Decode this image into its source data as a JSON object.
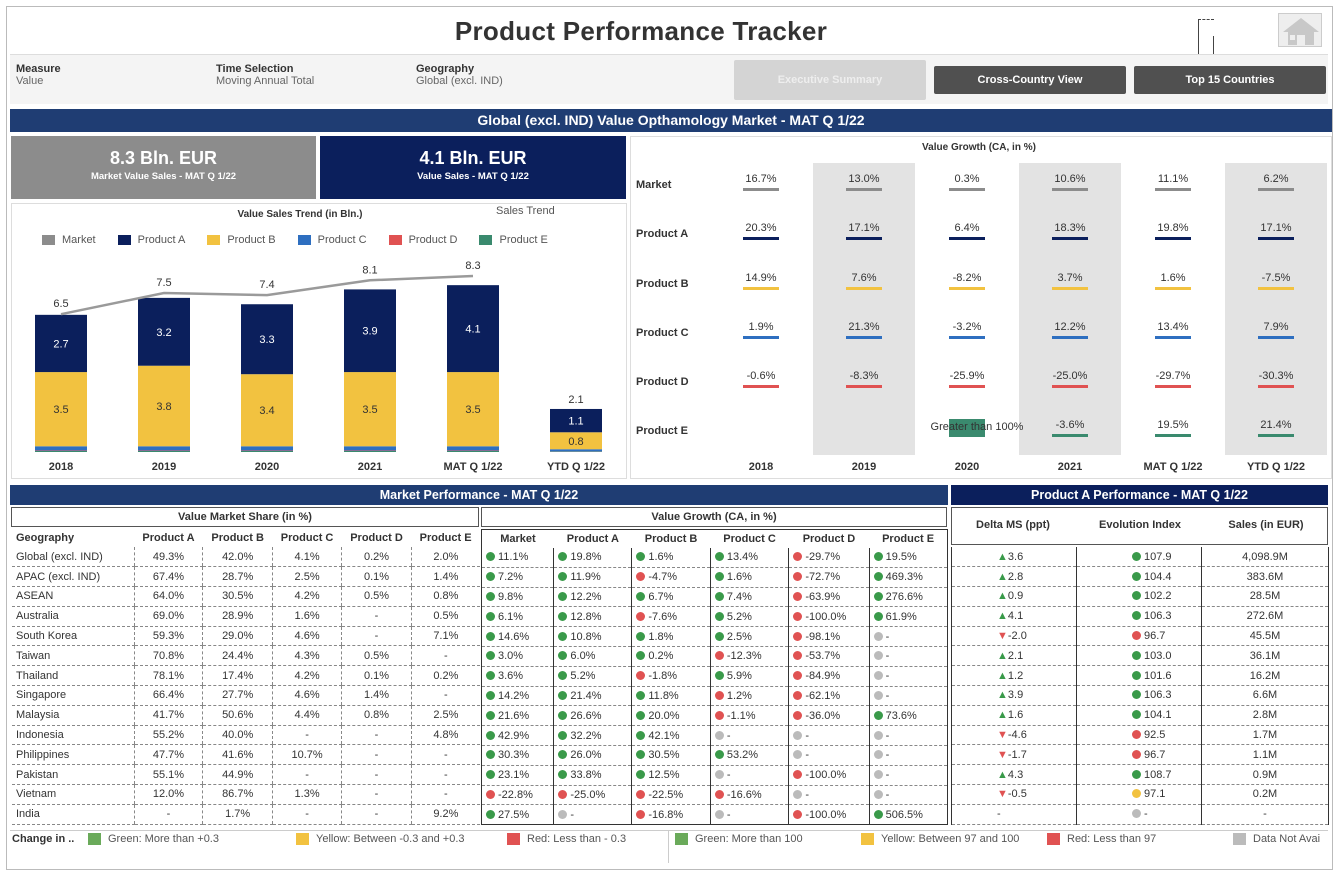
{
  "header": {
    "title": "Product Performance Tracker"
  },
  "filters": [
    {
      "label": "Measure",
      "value": "Value"
    },
    {
      "label": "Time Selection",
      "value": "Moving Annual Total"
    },
    {
      "label": "Geography",
      "value": "Global (excl. IND)"
    }
  ],
  "buttons": {
    "exec": "Executive Summary",
    "cross": "Cross-Country View",
    "top15": "Top 15 Countries"
  },
  "banner": "Global (excl. IND) Value Opthamology Market - MAT Q 1/22",
  "kpis": [
    {
      "value": "8.3 Bln. EUR",
      "label": "Market Value Sales - MAT Q 1/22",
      "color": "#8c8c8c"
    },
    {
      "value": "4.1 Bln. EUR",
      "label": "Value Sales - MAT Q 1/22",
      "color": "#0b1f5c"
    }
  ],
  "trend": {
    "title": "Value Sales Trend (in Bln.)",
    "tab": "Sales Trend"
  },
  "colors": {
    "Market": "#8c8c8c",
    "Product A": "#0b1f5c",
    "Product B": "#f2c240",
    "Product C": "#2e6fc0",
    "Product D": "#e05252",
    "Product E": "#3a8a6e",
    "navy": "#1f3d73",
    "green": "#3a9a4a",
    "red": "#e05252",
    "yellow": "#f2c240",
    "grey": "#bbbbbb"
  },
  "chart_data": {
    "type": "bar",
    "categories": [
      "2018",
      "2019",
      "2020",
      "2021",
      "MAT Q 1/22",
      "YTD Q 1/22"
    ],
    "legend": [
      "Market",
      "Product A",
      "Product B",
      "Product C",
      "Product D",
      "Product E"
    ],
    "series": [
      {
        "name": "Product A",
        "values": [
          2.7,
          3.2,
          3.3,
          3.9,
          4.1,
          1.1
        ]
      },
      {
        "name": "Product B",
        "values": [
          3.5,
          3.8,
          3.4,
          3.5,
          3.5,
          0.8
        ]
      },
      {
        "name": "Product C",
        "values": [
          0.2,
          0.2,
          0.2,
          0.2,
          0.2,
          0.1
        ]
      },
      {
        "name": "Product D",
        "values": [
          0.02,
          0.02,
          0.02,
          0.02,
          0.02,
          0.01
        ]
      },
      {
        "name": "Product E",
        "values": [
          0.05,
          0.05,
          0.05,
          0.05,
          0.05,
          0.02
        ]
      }
    ],
    "totals": [
      "",
      "",
      "",
      "",
      "",
      "2.1"
    ],
    "market": {
      "name": "Market",
      "values": [
        6.5,
        7.5,
        7.4,
        8.1,
        8.3
      ],
      "labels": [
        "6.5",
        "7.5",
        "7.4",
        "8.1",
        "8.3"
      ]
    },
    "ylim": [
      0,
      9
    ]
  },
  "growth": {
    "title": "Value Growth (CA, in %)",
    "years": [
      "2018",
      "2019",
      "2020",
      "2021",
      "MAT Q 1/22",
      "YTD Q 1/22"
    ],
    "rows": [
      {
        "label": "Market",
        "values": [
          "16.7%",
          "13.0%",
          "0.3%",
          "10.6%",
          "11.1%",
          "6.2%"
        ]
      },
      {
        "label": "Product A",
        "values": [
          "20.3%",
          "17.1%",
          "6.4%",
          "18.3%",
          "19.8%",
          "17.1%"
        ]
      },
      {
        "label": "Product B",
        "values": [
          "14.9%",
          "7.6%",
          "-8.2%",
          "3.7%",
          "1.6%",
          "-7.5%"
        ]
      },
      {
        "label": "Product C",
        "values": [
          "1.9%",
          "21.3%",
          "-3.2%",
          "12.2%",
          "13.4%",
          "7.9%"
        ]
      },
      {
        "label": "Product D",
        "values": [
          "-0.6%",
          "-8.3%",
          "-25.9%",
          "-25.0%",
          "-29.7%",
          "-30.3%"
        ]
      },
      {
        "label": "Product E",
        "values": [
          "",
          "",
          "Greater than 100%",
          "-3.6%",
          "19.5%",
          "21.4%"
        ]
      }
    ]
  },
  "market_perf": {
    "banner": "Market Performance - MAT Q 1/22",
    "share_title": "Value Market Share (in %)",
    "growth_title": "Value Growth (CA, in %)",
    "share_headers": [
      "Geography",
      "Product A",
      "Product B",
      "Product C",
      "Product D",
      "Product E"
    ],
    "growth_headers": [
      "Market",
      "Product A",
      "Product B",
      "Product C",
      "Product D",
      "Product E"
    ]
  },
  "prodA": {
    "banner": "Product A Performance - MAT Q 1/22",
    "headers": [
      "Delta MS (ppt)",
      "Evolution Index",
      "Sales (in EUR)"
    ]
  },
  "rows": [
    {
      "geo": "Global (excl. IND)",
      "share": [
        "49.3%",
        "42.0%",
        "4.1%",
        "0.2%",
        "2.0%"
      ],
      "growth": [
        [
          "g",
          "11.1%"
        ],
        [
          "g",
          "19.8%"
        ],
        [
          "g",
          "1.6%"
        ],
        [
          "g",
          "13.4%"
        ],
        [
          "r",
          "-29.7%"
        ],
        [
          "g",
          "19.5%"
        ]
      ],
      "delta": [
        "up",
        "3.6"
      ],
      "ei": [
        "g",
        "107.9"
      ],
      "sales": "4,098.9M"
    },
    {
      "geo": "APAC (excl. IND)",
      "share": [
        "67.4%",
        "28.7%",
        "2.5%",
        "0.1%",
        "1.4%"
      ],
      "growth": [
        [
          "g",
          "7.2%"
        ],
        [
          "g",
          "11.9%"
        ],
        [
          "r",
          "-4.7%"
        ],
        [
          "g",
          "1.6%"
        ],
        [
          "r",
          "-72.7%"
        ],
        [
          "g",
          "469.3%"
        ]
      ],
      "delta": [
        "up",
        "2.8"
      ],
      "ei": [
        "g",
        "104.4"
      ],
      "sales": "383.6M"
    },
    {
      "geo": "ASEAN",
      "share": [
        "64.0%",
        "30.5%",
        "4.2%",
        "0.5%",
        "0.8%"
      ],
      "growth": [
        [
          "g",
          "9.8%"
        ],
        [
          "g",
          "12.2%"
        ],
        [
          "g",
          "6.7%"
        ],
        [
          "g",
          "7.4%"
        ],
        [
          "r",
          "-63.9%"
        ],
        [
          "g",
          "276.6%"
        ]
      ],
      "delta": [
        "up",
        "0.9"
      ],
      "ei": [
        "g",
        "102.2"
      ],
      "sales": "28.5M"
    },
    {
      "geo": "Australia",
      "share": [
        "69.0%",
        "28.9%",
        "1.6%",
        "-",
        "0.5%"
      ],
      "growth": [
        [
          "g",
          "6.1%"
        ],
        [
          "g",
          "12.8%"
        ],
        [
          "r",
          "-7.6%"
        ],
        [
          "g",
          "5.2%"
        ],
        [
          "r",
          "-100.0%"
        ],
        [
          "g",
          "61.9%"
        ]
      ],
      "delta": [
        "up",
        "4.1"
      ],
      "ei": [
        "g",
        "106.3"
      ],
      "sales": "272.6M"
    },
    {
      "geo": "South Korea",
      "share": [
        "59.3%",
        "29.0%",
        "4.6%",
        "-",
        "7.1%"
      ],
      "growth": [
        [
          "g",
          "14.6%"
        ],
        [
          "g",
          "10.8%"
        ],
        [
          "g",
          "1.8%"
        ],
        [
          "g",
          "2.5%"
        ],
        [
          "r",
          "-98.1%"
        ],
        [
          "n",
          "-"
        ]
      ],
      "delta": [
        "down",
        "-2.0"
      ],
      "ei": [
        "r",
        "96.7"
      ],
      "sales": "45.5M"
    },
    {
      "geo": "Taiwan",
      "share": [
        "70.8%",
        "24.4%",
        "4.3%",
        "0.5%",
        "-"
      ],
      "growth": [
        [
          "g",
          "3.0%"
        ],
        [
          "g",
          "6.0%"
        ],
        [
          "g",
          "0.2%"
        ],
        [
          "r",
          "-12.3%"
        ],
        [
          "r",
          "-53.7%"
        ],
        [
          "n",
          "-"
        ]
      ],
      "delta": [
        "up",
        "2.1"
      ],
      "ei": [
        "g",
        "103.0"
      ],
      "sales": "36.1M"
    },
    {
      "geo": "Thailand",
      "share": [
        "78.1%",
        "17.4%",
        "4.2%",
        "0.1%",
        "0.2%"
      ],
      "growth": [
        [
          "g",
          "3.6%"
        ],
        [
          "g",
          "5.2%"
        ],
        [
          "r",
          "-1.8%"
        ],
        [
          "g",
          "5.9%"
        ],
        [
          "r",
          "-84.9%"
        ],
        [
          "n",
          "-"
        ]
      ],
      "delta": [
        "up",
        "1.2"
      ],
      "ei": [
        "g",
        "101.6"
      ],
      "sales": "16.2M"
    },
    {
      "geo": "Singapore",
      "share": [
        "66.4%",
        "27.7%",
        "4.6%",
        "1.4%",
        "-"
      ],
      "growth": [
        [
          "g",
          "14.2%"
        ],
        [
          "g",
          "21.4%"
        ],
        [
          "g",
          "11.8%"
        ],
        [
          "r",
          "1.2%"
        ],
        [
          "r",
          "-62.1%"
        ],
        [
          "n",
          "-"
        ]
      ],
      "delta": [
        "up",
        "3.9"
      ],
      "ei": [
        "g",
        "106.3"
      ],
      "sales": "6.6M"
    },
    {
      "geo": "Malaysia",
      "share": [
        "41.7%",
        "50.6%",
        "4.4%",
        "0.8%",
        "2.5%"
      ],
      "growth": [
        [
          "g",
          "21.6%"
        ],
        [
          "g",
          "26.6%"
        ],
        [
          "g",
          "20.0%"
        ],
        [
          "r",
          "-1.1%"
        ],
        [
          "r",
          "-36.0%"
        ],
        [
          "g",
          "73.6%"
        ]
      ],
      "delta": [
        "up",
        "1.6"
      ],
      "ei": [
        "g",
        "104.1"
      ],
      "sales": "2.8M"
    },
    {
      "geo": "Indonesia",
      "share": [
        "55.2%",
        "40.0%",
        "-",
        "-",
        "4.8%"
      ],
      "growth": [
        [
          "g",
          "42.9%"
        ],
        [
          "g",
          "32.2%"
        ],
        [
          "g",
          "42.1%"
        ],
        [
          "n",
          "-"
        ],
        [
          "n",
          "-"
        ],
        [
          "n",
          "-"
        ]
      ],
      "delta": [
        "down",
        "-4.6"
      ],
      "ei": [
        "r",
        "92.5"
      ],
      "sales": "1.7M"
    },
    {
      "geo": "Philippines",
      "share": [
        "47.7%",
        "41.6%",
        "10.7%",
        "-",
        "-"
      ],
      "growth": [
        [
          "g",
          "30.3%"
        ],
        [
          "g",
          "26.0%"
        ],
        [
          "g",
          "30.5%"
        ],
        [
          "g",
          "53.2%"
        ],
        [
          "n",
          "-"
        ],
        [
          "n",
          "-"
        ]
      ],
      "delta": [
        "down",
        "-1.7"
      ],
      "ei": [
        "r",
        "96.7"
      ],
      "sales": "1.1M"
    },
    {
      "geo": "Pakistan",
      "share": [
        "55.1%",
        "44.9%",
        "-",
        "-",
        "-"
      ],
      "growth": [
        [
          "g",
          "23.1%"
        ],
        [
          "g",
          "33.8%"
        ],
        [
          "g",
          "12.5%"
        ],
        [
          "n",
          "-"
        ],
        [
          "r",
          "-100.0%"
        ],
        [
          "n",
          "-"
        ]
      ],
      "delta": [
        "up",
        "4.3"
      ],
      "ei": [
        "g",
        "108.7"
      ],
      "sales": "0.9M"
    },
    {
      "geo": "Vietnam",
      "share": [
        "12.0%",
        "86.7%",
        "1.3%",
        "-",
        "-"
      ],
      "growth": [
        [
          "r",
          "-22.8%"
        ],
        [
          "r",
          "-25.0%"
        ],
        [
          "r",
          "-22.5%"
        ],
        [
          "r",
          "-16.6%"
        ],
        [
          "n",
          "-"
        ],
        [
          "n",
          "-"
        ]
      ],
      "delta": [
        "down",
        "-0.5"
      ],
      "ei": [
        "y",
        "97.1"
      ],
      "sales": "0.2M"
    },
    {
      "geo": "India",
      "share": [
        "-",
        "1.7%",
        "-",
        "-",
        "9.2%"
      ],
      "growth": [
        [
          "g",
          "27.5%"
        ],
        [
          "n",
          "-"
        ],
        [
          "r",
          "-16.8%"
        ],
        [
          "n",
          "-"
        ],
        [
          "r",
          "-100.0%"
        ],
        [
          "g",
          "506.5%"
        ]
      ],
      "delta": [
        "none",
        "-"
      ],
      "ei": [
        "n",
        "-"
      ],
      "sales": "-"
    }
  ],
  "footer": {
    "lead": "Change in ..",
    "items": [
      {
        "color": "#6aaa5a",
        "text": "Green: More than +0.3"
      },
      {
        "color": "#f2c240",
        "text": "Yellow: Between -0.3 and +0.3"
      },
      {
        "color": "#e05252",
        "text": "Red: Less than - 0.3"
      },
      {
        "color": "#6aaa5a",
        "text": "Green: More than 100"
      },
      {
        "color": "#f2c240",
        "text": "Yellow: Between 97 and 100"
      },
      {
        "color": "#e05252",
        "text": "Red: Less than 97"
      },
      {
        "color": "#bbbbbb",
        "text": "Data Not Avai"
      }
    ]
  }
}
